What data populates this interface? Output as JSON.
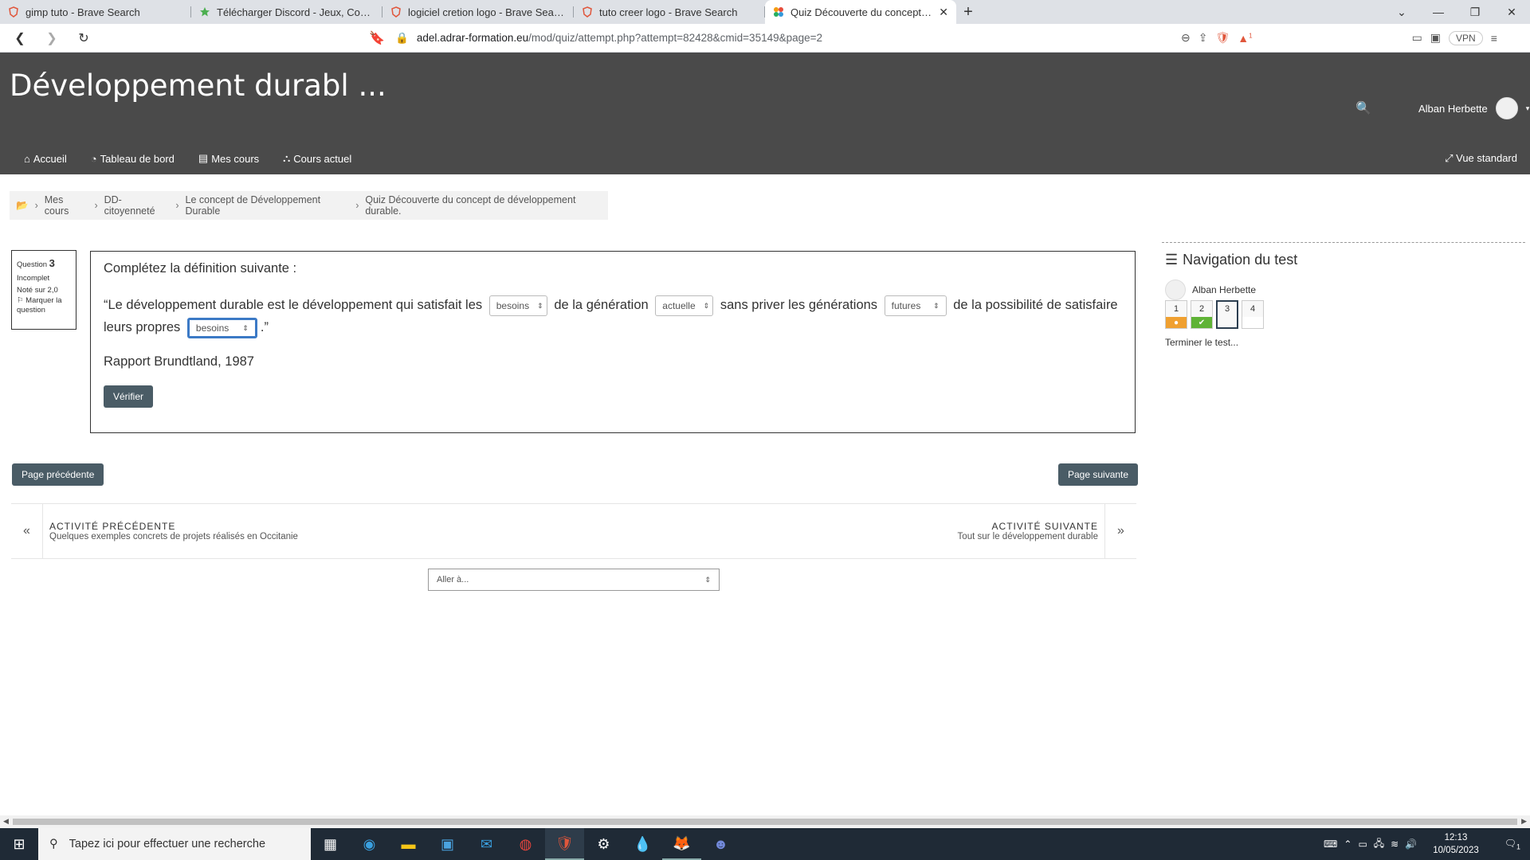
{
  "browser": {
    "tabs": [
      {
        "title": "gimp tuto - Brave Search",
        "icon": "brave-icon",
        "active": false
      },
      {
        "title": "Télécharger Discord - Jeux, Communic",
        "icon": "star-icon",
        "active": false
      },
      {
        "title": "logiciel cretion logo - Brave Search",
        "icon": "brave-icon",
        "active": false
      },
      {
        "title": "tuto creer logo - Brave Search",
        "icon": "brave-icon",
        "active": false
      },
      {
        "title": "Quiz Découverte du concept de d",
        "icon": "moodle-icon",
        "active": true
      }
    ],
    "url_host": "adel.adrar-formation.eu",
    "url_path": "/mod/quiz/attempt.php?attempt=82428&cmid=35149&page=2",
    "vpn_label": "VPN",
    "brave_badge": "1"
  },
  "header": {
    "site_title": "Développement durabl ...",
    "user_name": "Alban Herbette",
    "nav": [
      "Accueil",
      "Tableau de bord",
      "Mes cours",
      "Cours actuel"
    ],
    "view_mode": "Vue standard"
  },
  "breadcrumb": [
    "Mes cours",
    "DD-citoyenneté",
    "Le concept de Développement Durable",
    "Quiz Découverte du concept de développement durable."
  ],
  "question_info": {
    "label": "Question",
    "number": "3",
    "status": "Incomplet",
    "grade": "Noté sur 2,0",
    "flag": "Marquer la question"
  },
  "question": {
    "prompt": "Complétez la définition suivante :",
    "part1": "“Le développement durable est le développement qui satisfait les",
    "select1": "besoins",
    "part2": "de la génération",
    "select2": "actuelle",
    "part3": "sans priver les générations",
    "select3": "futures",
    "part4": "de la possibilité de satisfaire leurs propres",
    "select4": "besoins",
    "part5": ".”",
    "source": "Rapport Brundtland, 1987",
    "check_button": "Vérifier"
  },
  "quiz_nav": {
    "title": "Navigation du test",
    "user": "Alban Herbette",
    "questions": [
      {
        "n": "1",
        "state": "incomplete",
        "color": "#f0a030"
      },
      {
        "n": "2",
        "state": "correct",
        "color": "#5fb336"
      },
      {
        "n": "3",
        "state": "current",
        "color": ""
      },
      {
        "n": "4",
        "state": "unanswered",
        "color": ""
      }
    ],
    "finish": "Terminer le test..."
  },
  "page_nav": {
    "prev": "Page précédente",
    "next": "Page suivante"
  },
  "activity_nav": {
    "prev_label": "ACTIVITÉ PRÉCÉDENTE",
    "prev_title": "Quelques exemples concrets de projets réalisés en Occitanie",
    "next_label": "ACTIVITÉ SUIVANTE",
    "next_title": "Tout sur le développement durable",
    "jump_placeholder": "Aller à..."
  },
  "taskbar": {
    "search_placeholder": "Tapez ici pour effectuer une recherche",
    "time": "12:13",
    "date": "10/05/2023",
    "notifications": "1"
  },
  "colors": {
    "header_bg": "#4a4a4a",
    "button_bg": "#4a5c66",
    "focus_border": "#3c7ac6"
  }
}
